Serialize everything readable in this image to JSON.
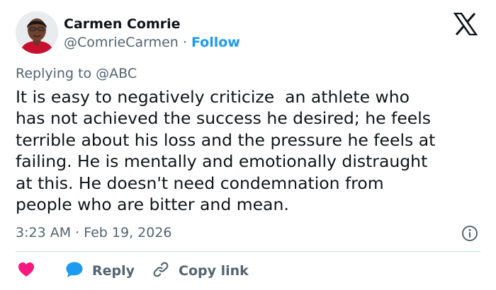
{
  "author": {
    "name": "Carmen Comrie",
    "handle": "@ComrieCarmen",
    "separator": "·",
    "follow_label": "Follow"
  },
  "reply_context": "Replying to @ABC",
  "tweet": {
    "text": "It is easy to negatively criticize  an athlete who\nhas not achieved the success he desired; he feels\nterrible about his loss and the pressure he feels at\nfailing. He is mentally and emotionally distraught\nat this. He doesn't need condemnation from\npeople who are bitter and mean.",
    "timestamp": "3:23 AM · Feb 19, 2026"
  },
  "actions": {
    "reply_label": "Reply",
    "copy_label": "Copy link"
  },
  "icons": {
    "brand": "x-logo-icon",
    "info": "info-icon",
    "like": "heart-icon",
    "reply": "reply-bubble-icon",
    "copy": "link-icon"
  },
  "colors": {
    "accent": "#1d9bf0",
    "like": "#f91880",
    "text_primary": "#0f1419",
    "text_secondary": "#536471",
    "divider": "#cfd9de"
  }
}
